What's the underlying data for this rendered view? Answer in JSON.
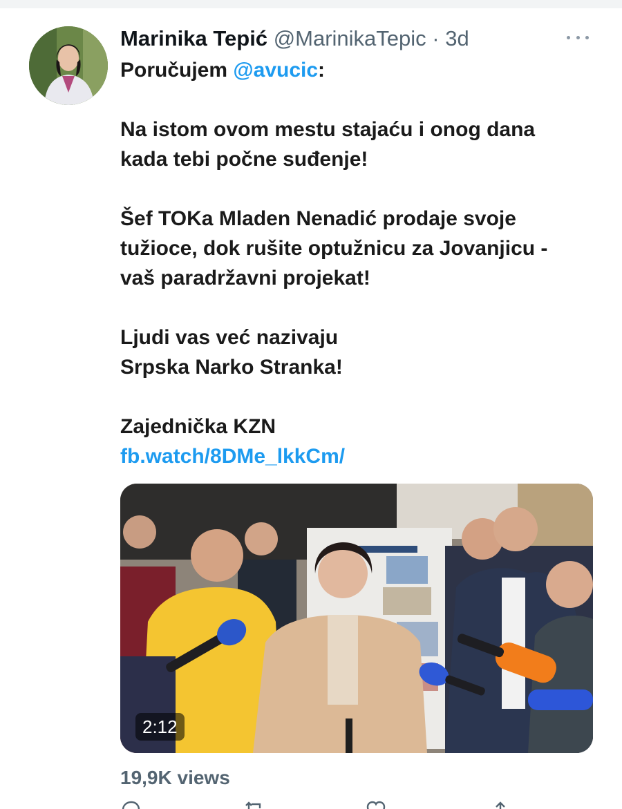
{
  "tweet": {
    "display_name": "Marinika Tepić",
    "handle": "@MarinikaTepic",
    "separator": "·",
    "time": "3d",
    "intro_text": "Poručujem ",
    "mention": "@avucic",
    "intro_suffix": ":",
    "para1_line1": "Na istom ovom mestu stajaću i onog dana",
    "para1_line2": "kada tebi počne suđenje!",
    "para2_line1": "Šef TOKa Mladen Nenadić prodaje svoje",
    "para2_line2": "tužioce, dok rušite optužnicu za Jovanjicu -",
    "para2_line3": "vaš paradržavni projekat!",
    "para3_line1": "Ljudi vas već nazivaju",
    "para3_line2": "Srpska Narko Stranka!",
    "para4_line1": "Zajednička KZN",
    "link": "fb.watch/8DMe_lkkCm/",
    "video_duration": "2:12",
    "views": "19,9K views"
  },
  "icons": {
    "more": "more-icon",
    "reply": "reply-icon",
    "retweet": "retweet-icon",
    "like": "like-icon",
    "share": "share-icon"
  },
  "colors": {
    "link": "#1d9bf0",
    "secondary_text": "#536471"
  }
}
